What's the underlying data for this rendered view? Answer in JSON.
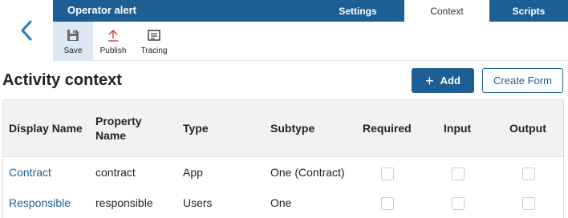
{
  "header": {
    "title": "Operator alert",
    "tabs": [
      "Settings",
      "Context",
      "Scripts"
    ],
    "active_tab": "Context"
  },
  "toolbar": {
    "save": "Save",
    "publish": "Publish",
    "tracing": "Tracing"
  },
  "main": {
    "title": "Activity context",
    "add_button": "Add",
    "create_form_button": "Create Form"
  },
  "table": {
    "columns": [
      "Display Name",
      "Property Name",
      "Type",
      "Subtype",
      "Required",
      "Input",
      "Output"
    ],
    "rows": [
      {
        "display_name": "Contract",
        "property_name": "contract",
        "type": "App",
        "subtype": "One (Contract)",
        "required": false,
        "input": false,
        "output": false
      },
      {
        "display_name": "Responsible",
        "property_name": "responsible",
        "type": "Users",
        "subtype": "One",
        "required": false,
        "input": false,
        "output": false
      }
    ]
  },
  "colors": {
    "brand": "#1d5f94",
    "active_tool_bg": "#dce9f5",
    "publish_icon": "#d9534f"
  }
}
